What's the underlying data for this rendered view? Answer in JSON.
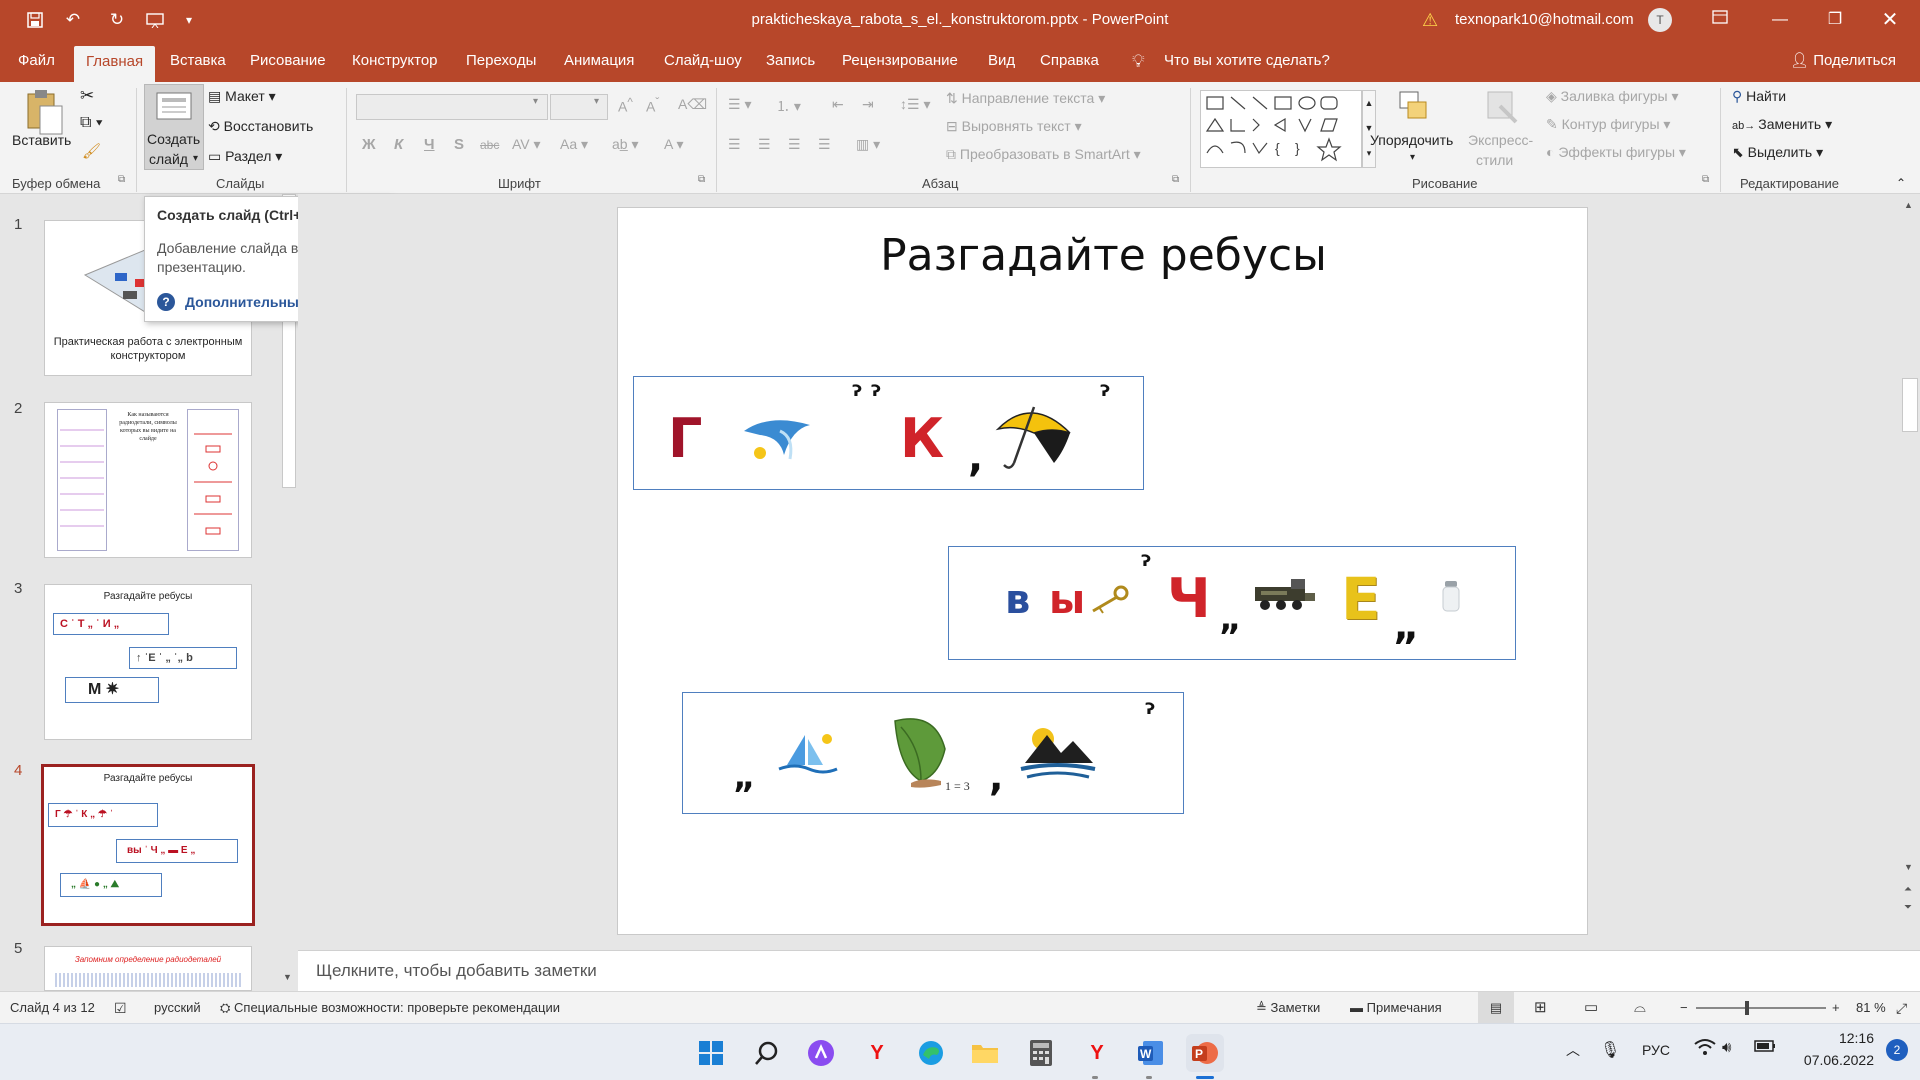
{
  "titlebar": {
    "doc_title": "prakticheskaya_rabota_s_el._konstruktorom.pptx  -  PowerPoint",
    "account": "texnopark10@hotmail.com",
    "avatar_letter": "T"
  },
  "tabs": [
    "Файл",
    "Главная",
    "Вставка",
    "Рисование",
    "Конструктор",
    "Переходы",
    "Анимация",
    "Слайд-шоу",
    "Запись",
    "Рецензирование",
    "Вид",
    "Справка"
  ],
  "tell_me": "Что вы хотите сделать?",
  "share": "Поделиться",
  "ribbon": {
    "clipboard": {
      "paste": "Вставить",
      "label": "Буфер обмена"
    },
    "slides": {
      "new_slide_1": "Создать",
      "new_slide_2": "слайд",
      "layout": "Макет",
      "reset": "Восстановить",
      "section": "Раздел",
      "label": "Слайды"
    },
    "font": {
      "label": "Шрифт",
      "bold": "Ж",
      "italic": "К",
      "underline": "Ч",
      "shadow": "S",
      "strike": "abc",
      "spacing": "AV",
      "case": "Aa"
    },
    "paragraph": {
      "text_direction": "Направление текста",
      "align_text": "Выровнять текст",
      "smartart": "Преобразовать в SmartArt",
      "label": "Абзац"
    },
    "drawing": {
      "arrange": "Упорядочить",
      "quick_styles_1": "Экспресс-",
      "quick_styles_2": "стили",
      "fill": "Заливка фигуры",
      "outline": "Контур фигуры",
      "effects": "Эффекты фигуры",
      "label": "Рисование"
    },
    "editing": {
      "find": "Найти",
      "replace": "Заменить",
      "select": "Выделить",
      "label": "Редактирование"
    }
  },
  "tooltip": {
    "title": "Создать слайд (Ctrl+M)",
    "body": "Добавление слайда в презентацию.",
    "link": "Дополнительные сведения"
  },
  "thumbnails": [
    {
      "num": "1",
      "caption": "Практическая работа с электронным конструктором"
    },
    {
      "num": "2",
      "caption": "Как называются радиодетали, символы которых вы видите на слайде"
    },
    {
      "num": "3",
      "caption": "Разгадайте ребусы"
    },
    {
      "num": "4",
      "caption": "Разгадайте ребусы"
    },
    {
      "num": "5",
      "caption": "Запомним определение радиодеталей"
    }
  ],
  "slide": {
    "title": "Разгадайте ребусы",
    "rebus1": {
      "letter1": "Г",
      "letter2": "К"
    },
    "rebus2": {
      "letter1": "в",
      "letter2": "ы",
      "letter3": "Ч",
      "letter4": "Е"
    },
    "rebus3": {
      "formula": "1  = 3"
    }
  },
  "notes_placeholder": "Щелкните, чтобы добавить заметки",
  "status": {
    "slide_of": "Слайд 4 из 12",
    "language": "русский",
    "accessibility": "Специальные возможности: проверьте рекомендации",
    "notes": "Заметки",
    "comments": "Примечания",
    "zoom": "81 %",
    "zoom_level": 0.81
  },
  "taskbar": {
    "lang": "РУС",
    "time": "12:16",
    "date": "07.06.2022",
    "notifications": "2"
  }
}
